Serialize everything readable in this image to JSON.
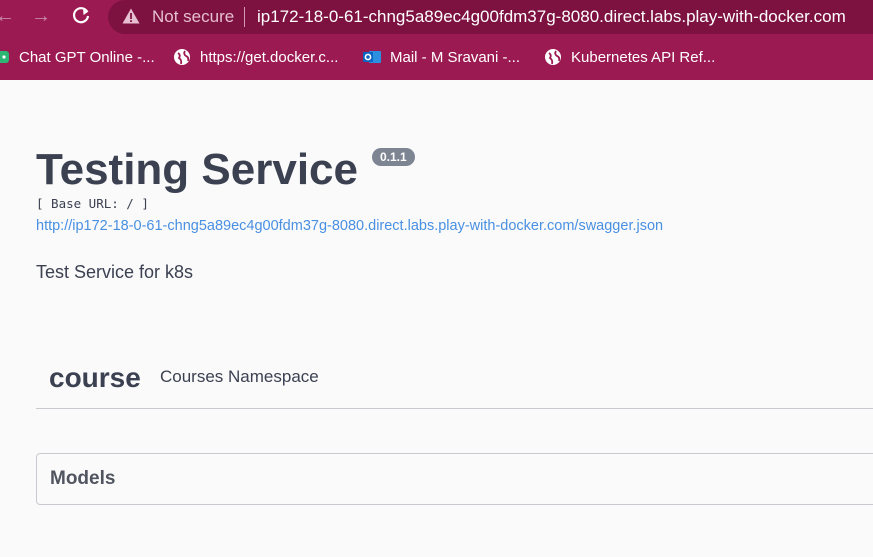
{
  "browser": {
    "security_label": "Not secure",
    "url": "ip172-18-0-61-chng5a89ec4g00fdm37g-8080.direct.labs.play-with-docker.com",
    "bookmarks": [
      {
        "label": "Chat GPT Online -...",
        "icon": "chatgpt-icon"
      },
      {
        "label": "https://get.docker.c...",
        "icon": "globe-icon"
      },
      {
        "label": "Mail - M Sravani -...",
        "icon": "outlook-icon"
      },
      {
        "label": "Kubernetes API Ref...",
        "icon": "globe-icon"
      }
    ],
    "colors": {
      "frame": "#9c1a52",
      "omnibox": "#7d1241"
    }
  },
  "info": {
    "title": "Testing Service",
    "version": "0.1.1",
    "base_url": "[ Base URL: / ]",
    "spec_url": "http://ip172-18-0-61-chng5a89ec4g00fdm37g-8080.direct.labs.play-with-docker.com/swagger.json",
    "description": "Test Service for k8s"
  },
  "tags": [
    {
      "name": "course",
      "description": "Courses Namespace"
    }
  ],
  "models": {
    "title": "Models"
  },
  "colors": {
    "text": "#3b4151",
    "link": "#4990e2",
    "version_badge": "#7d8492"
  }
}
